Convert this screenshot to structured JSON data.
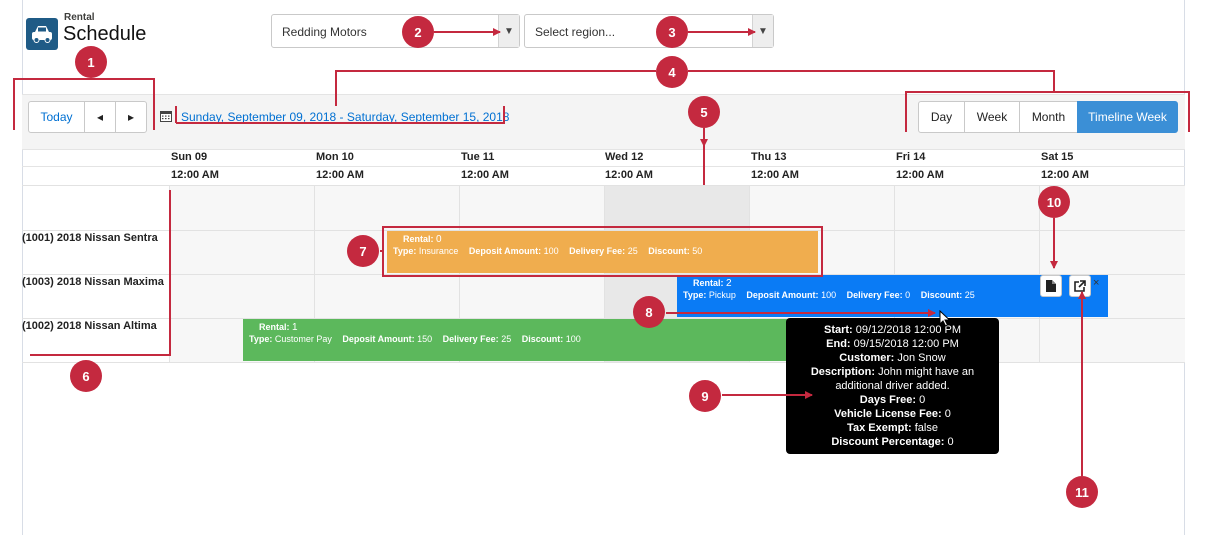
{
  "header": {
    "app_subtitle": "Rental",
    "app_title": "Schedule"
  },
  "filters": {
    "dealer": {
      "selected": "Redding Motors"
    },
    "region": {
      "placeholder": "Select region..."
    }
  },
  "toolbar": {
    "today_label": "Today",
    "prev_label": "◂",
    "next_label": "▸",
    "date_range": "Sunday, September 09, 2018 - Saturday, September 15, 2018",
    "views": [
      "Day",
      "Week",
      "Month",
      "Timeline Week"
    ],
    "active_view": "Timeline Week"
  },
  "columns": [
    {
      "day": "Sun 09",
      "time": "12:00 AM"
    },
    {
      "day": "Mon 10",
      "time": "12:00 AM"
    },
    {
      "day": "Tue 11",
      "time": "12:00 AM"
    },
    {
      "day": "Wed 12",
      "time": "12:00 AM"
    },
    {
      "day": "Thu 13",
      "time": "12:00 AM"
    },
    {
      "day": "Fri 14",
      "time": "12:00 AM"
    },
    {
      "day": "Sat 15",
      "time": "12:00 AM"
    }
  ],
  "resources": [
    {
      "label": "(1001) 2018 Nissan Sentra"
    },
    {
      "label": "(1003) 2018 Nissan Maxima"
    },
    {
      "label": "(1002) 2018 Nissan Altima"
    }
  ],
  "events": [
    {
      "rental_label": "Rental:",
      "rental_value": "0",
      "type_label": "Type:",
      "type_value": "Insurance",
      "deposit_label": "Deposit Amount:",
      "deposit_value": "100",
      "delivery_label": "Delivery Fee:",
      "delivery_value": "25",
      "discount_label": "Discount:",
      "discount_value": "50",
      "color": "#f0ad4e"
    },
    {
      "rental_label": "Rental:",
      "rental_value": "2",
      "type_label": "Type:",
      "type_value": "Pickup",
      "deposit_label": "Deposit Amount:",
      "deposit_value": "100",
      "delivery_label": "Delivery Fee:",
      "delivery_value": "0",
      "discount_label": "Discount:",
      "discount_value": "25",
      "color": "#0a7bf5"
    },
    {
      "rental_label": "Rental:",
      "rental_value": "1",
      "type_label": "Type:",
      "type_value": "Customer Pay",
      "deposit_label": "Deposit Amount:",
      "deposit_value": "150",
      "delivery_label": "Delivery Fee:",
      "delivery_value": "25",
      "discount_label": "Discount:",
      "discount_value": "100",
      "color": "#5cb85c"
    }
  ],
  "event_actions": {
    "close_label": "×"
  },
  "tooltip": {
    "start_label": "Start:",
    "start_value": "09/12/2018 12:00 PM",
    "end_label": "End:",
    "end_value": "09/15/2018 12:00 PM",
    "customer_label": "Customer:",
    "customer_value": "Jon Snow",
    "description_label": "Description:",
    "description_value": "John might have an additional driver added.",
    "days_free_label": "Days Free:",
    "days_free_value": "0",
    "vlf_label": "Vehicle License Fee:",
    "vlf_value": "0",
    "tax_label": "Tax Exempt:",
    "tax_value": "false",
    "discount_pct_label": "Discount Percentage:",
    "discount_pct_value": "0"
  },
  "callouts": [
    "1",
    "2",
    "3",
    "4",
    "5",
    "6",
    "7",
    "8",
    "9",
    "10",
    "11"
  ],
  "colors": {
    "callout": "#c4293f",
    "accent": "#0070d2",
    "active_view": "#3b8fd6"
  }
}
